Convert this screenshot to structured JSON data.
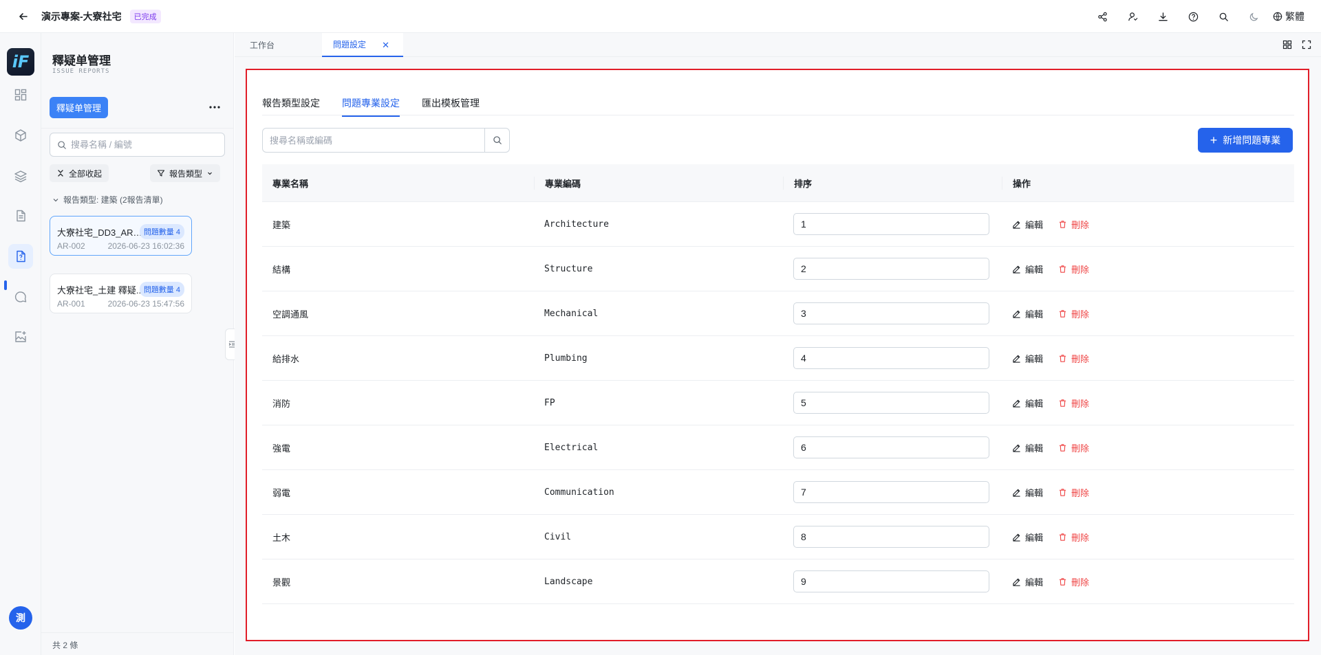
{
  "header": {
    "project_title": "演示專案-大寮社宅",
    "status": "已完成",
    "language": "繁體"
  },
  "sidebar": {
    "title": "釋疑单管理",
    "subtitle": "ISSUE REPORTS",
    "primary_button": "釋疑单管理",
    "search_placeholder": "搜尋名稱 / 編號",
    "collapse_all": "全部收起",
    "filter_label": "報告類型",
    "group_label": "報告類型: 建築 (2報告清單)",
    "cards": [
      {
        "title": "大寮社宅_DD3_AR_E...",
        "badge": "問題數量 4",
        "code": "AR-002",
        "time": "2026-06-23 16:02:36"
      },
      {
        "title": "大寮社宅_土建 釋疑...",
        "badge": "問題數量 4",
        "code": "AR-001",
        "time": "2026-06-23 15:47:56"
      }
    ],
    "footer": "共 2 條"
  },
  "rail": {
    "logo_text": "iF",
    "avatar_text": "測"
  },
  "workspace_tabs": [
    {
      "label": "工作台"
    },
    {
      "label": "問題設定"
    }
  ],
  "panel": {
    "subtabs": [
      "報告類型設定",
      "問題專業設定",
      "匯出模板管理"
    ],
    "search_placeholder": "搜尋名稱或編碼",
    "add_button": "新增問題專業",
    "columns": [
      "專業名稱",
      "專業編碼",
      "排序",
      "操作"
    ],
    "edit_label": "編輯",
    "delete_label": "刪除",
    "rows": [
      {
        "name": "建築",
        "code": "Architecture",
        "order": "1"
      },
      {
        "name": "結構",
        "code": "Structure",
        "order": "2"
      },
      {
        "name": "空調通風",
        "code": "Mechanical",
        "order": "3"
      },
      {
        "name": "給排水",
        "code": "Plumbing",
        "order": "4"
      },
      {
        "name": "消防",
        "code": "FP",
        "order": "5"
      },
      {
        "name": "強電",
        "code": "Electrical",
        "order": "6"
      },
      {
        "name": "弱電",
        "code": "Communication",
        "order": "7"
      },
      {
        "name": "土木",
        "code": "Civil",
        "order": "8"
      },
      {
        "name": "景觀",
        "code": "Landscape",
        "order": "9"
      }
    ]
  },
  "colors": {
    "accent": "#2563eb",
    "danger": "#ef4444",
    "highlight_border": "#e11d28"
  }
}
